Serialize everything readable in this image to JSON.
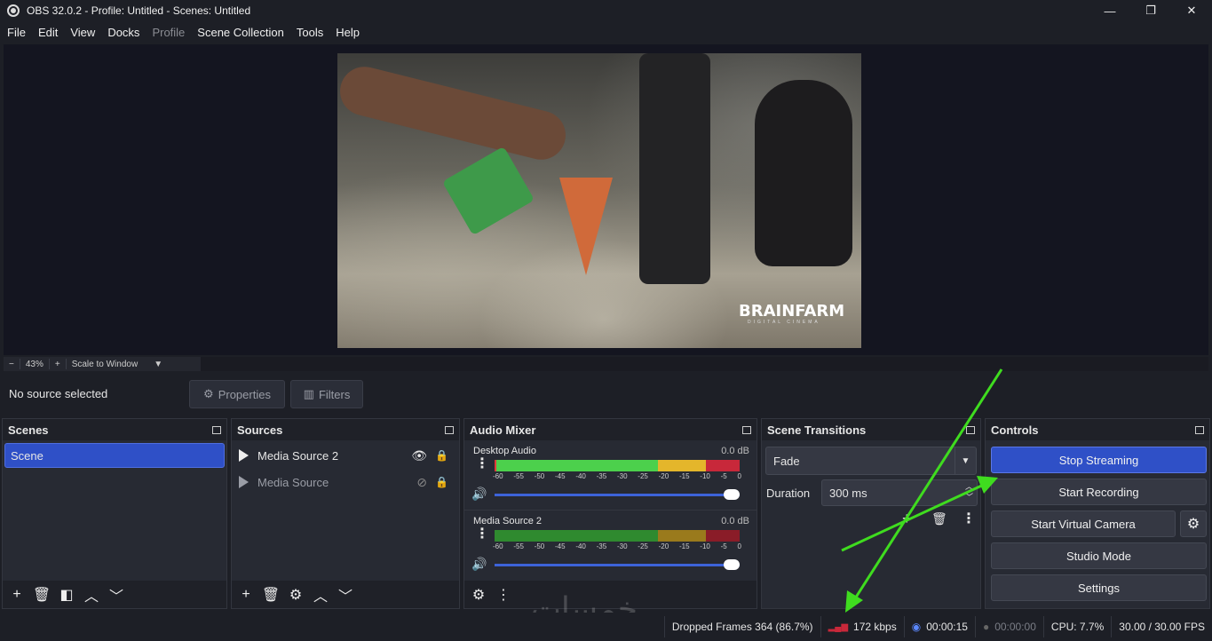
{
  "window": {
    "title": "OBS 32.0.2 - Profile: Untitled - Scenes: Untitled",
    "minimize": "—",
    "maximize": "❐",
    "close": "✕"
  },
  "menu": {
    "items": [
      "File",
      "Edit",
      "View",
      "Docks",
      "Profile",
      "Scene Collection",
      "Tools",
      "Help"
    ]
  },
  "preview": {
    "brand": "BRAINFARM",
    "brand_sub": "DIGITAL CINEMA"
  },
  "zoom": {
    "minus": "−",
    "value": "43%",
    "plus": "+",
    "scale_mode": "Scale to Window"
  },
  "infobar": {
    "no_source": "No source selected",
    "properties": "Properties",
    "filters": "Filters"
  },
  "scenes": {
    "title": "Scenes",
    "items": [
      "Scene"
    ]
  },
  "sources": {
    "title": "Sources",
    "items": [
      {
        "name": "Media Source 2",
        "visible": true
      },
      {
        "name": "Media Source",
        "visible": false
      }
    ]
  },
  "mixer": {
    "title": "Audio Mixer",
    "scale": [
      "-60",
      "-55",
      "-50",
      "-45",
      "-40",
      "-35",
      "-30",
      "-25",
      "-20",
      "-15",
      "-10",
      "-5",
      "0"
    ],
    "channels": [
      {
        "name": "Desktop Audio",
        "db": "0.0 dB",
        "level": 0.96
      },
      {
        "name": "Media Source 2",
        "db": "0.0 dB",
        "level": 0.96
      }
    ]
  },
  "transitions": {
    "title": "Scene Transitions",
    "selected": "Fade",
    "duration_label": "Duration",
    "duration_value": "300 ms"
  },
  "controls": {
    "title": "Controls",
    "stop_streaming": "Stop Streaming",
    "start_recording": "Start Recording",
    "start_virtual_camera": "Start Virtual Camera",
    "studio_mode": "Studio Mode",
    "settings": "Settings"
  },
  "status": {
    "dropped_frames": "Dropped Frames 364 (86.7%)",
    "bitrate": "172 kbps",
    "stream_time": "00:00:15",
    "record_time": "00:00:00",
    "cpu": "CPU: 7.7%",
    "fps": "30.00 / 30.00 FPS"
  },
  "watermark": "خمسات",
  "colors": {
    "accent": "#2f50c7",
    "arrow": "#3fdc1f"
  }
}
